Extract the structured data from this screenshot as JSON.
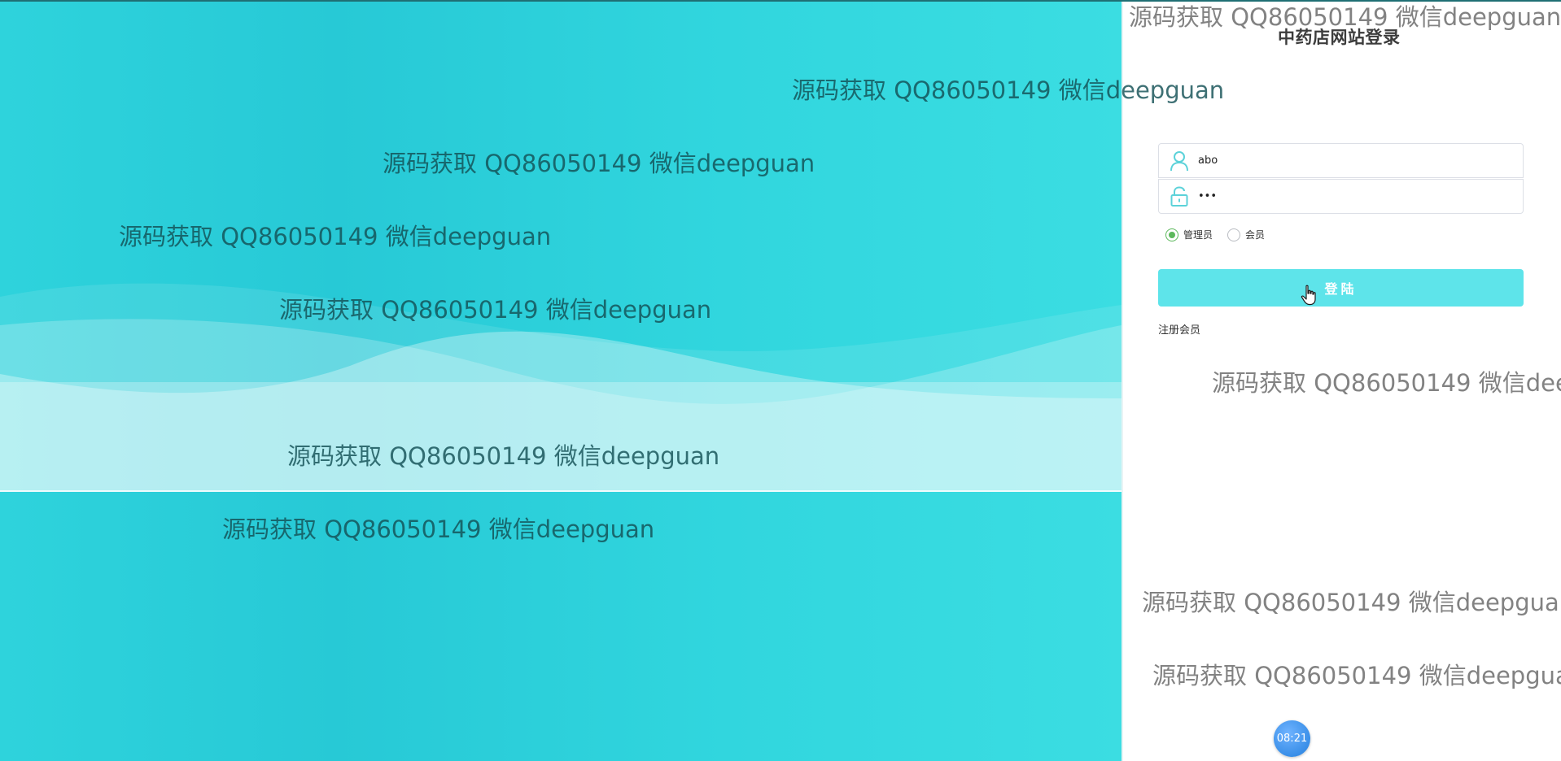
{
  "login": {
    "title": "中药店网站登录",
    "username_value": "abo",
    "password_value": "•••",
    "roles": [
      {
        "label": "管理员",
        "checked": true
      },
      {
        "label": "会员",
        "checked": false
      }
    ],
    "submit_label": "登陆",
    "register_label": "注册会员"
  },
  "watermark": {
    "text": "源码获取 QQ86050149 微信deepguan"
  },
  "clock": {
    "time": "08:21"
  },
  "colors": {
    "hero_gradient_start": "#2ed3dc",
    "hero_gradient_end": "#3bdde2",
    "button_bg": "#5ee4ea",
    "radio_checked": "#5cb85c",
    "clock_bg": "#3a8fe8"
  },
  "icons": {
    "username": "user-icon",
    "password": "lock-icon",
    "pointer": "hand-cursor-icon"
  }
}
